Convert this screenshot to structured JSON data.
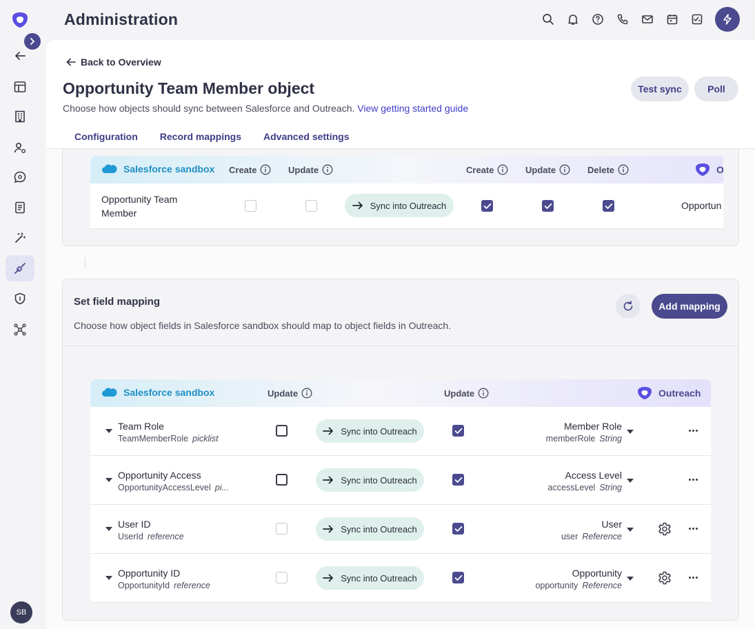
{
  "header": {
    "title": "Administration"
  },
  "sidebar": {
    "avatar_initials": "SB",
    "items": [
      {
        "icon": "arrow-left-icon"
      },
      {
        "icon": "layout-icon"
      },
      {
        "icon": "building-icon"
      },
      {
        "icon": "user-settings-icon"
      },
      {
        "icon": "chat-gear-icon"
      },
      {
        "icon": "document-icon"
      },
      {
        "icon": "magic-wand-icon"
      },
      {
        "icon": "plug-icon",
        "active": true
      },
      {
        "icon": "shield-icon"
      },
      {
        "icon": "network-icon"
      }
    ]
  },
  "page": {
    "back_label": "Back to Overview",
    "title": "Opportunity Team Member object",
    "subtitle": "Choose how objects should sync between Salesforce and Outreach.",
    "guide_link": "View getting started guide",
    "test_sync_label": "Test sync",
    "poll_label": "Poll",
    "tabs": [
      "Configuration",
      "Record mappings",
      "Advanced settings"
    ]
  },
  "object_card": {
    "source_label": "Salesforce sandbox",
    "source_cols": [
      "Create",
      "Update"
    ],
    "target_cols": [
      "Create",
      "Update",
      "Delete"
    ],
    "target_label_clipped": "O",
    "row": {
      "name": "Opportunity Team Member",
      "sync_label": "Sync into Outreach",
      "target_name_clipped": "Opportun",
      "source_create": false,
      "source_update": false,
      "target_create": true,
      "target_update": true,
      "target_delete": true
    }
  },
  "field_mapping": {
    "title": "Set field mapping",
    "subtitle": "Choose how object fields in Salesforce sandbox should map to object fields in Outreach.",
    "add_label": "Add mapping",
    "source_label": "Salesforce sandbox",
    "source_update_label": "Update",
    "target_update_label": "Update",
    "target_label": "Outreach",
    "rows": [
      {
        "field": "Team Role",
        "api": "TeamMemberRole",
        "type": "picklist",
        "sync": "Sync into Outreach",
        "target": "Member Role",
        "target_api": "memberRole",
        "target_type": "String",
        "source_update": false,
        "source_enabled": true,
        "target_update": true,
        "gear": false
      },
      {
        "field": "Opportunity Access",
        "api": "OpportunityAccessLevel",
        "type": "pi...",
        "sync": "Sync into Outreach",
        "target": "Access Level",
        "target_api": "accessLevel",
        "target_type": "String",
        "source_update": false,
        "source_enabled": true,
        "target_update": true,
        "gear": false
      },
      {
        "field": "User ID",
        "api": "UserId",
        "type": "reference",
        "sync": "Sync into Outreach",
        "target": "User",
        "target_api": "user",
        "target_type": "Reference",
        "source_update": false,
        "source_enabled": false,
        "target_update": true,
        "gear": true
      },
      {
        "field": "Opportunity ID",
        "api": "OpportunityId",
        "type": "reference",
        "sync": "Sync into Outreach",
        "target": "Opportunity",
        "target_api": "opportunity",
        "target_type": "Reference",
        "source_update": false,
        "source_enabled": false,
        "target_update": true,
        "gear": true
      }
    ]
  },
  "colors": {
    "accent": "#4b4a8f",
    "link": "#3f3dc7",
    "salesforce": "#1f8fc4",
    "sync_pill": "#dff0ec"
  }
}
